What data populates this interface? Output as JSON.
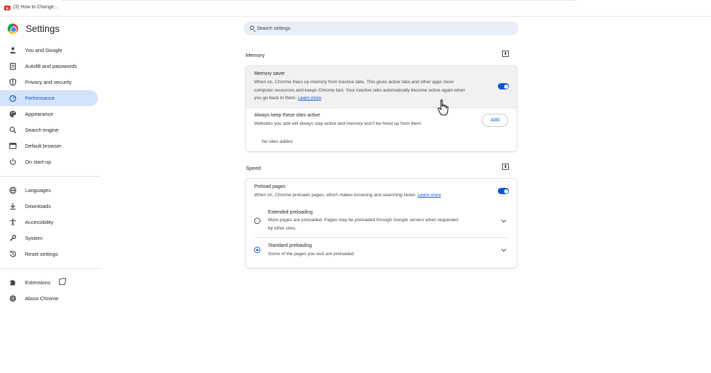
{
  "tab": {
    "title": "(3) How to Change..."
  },
  "header": {
    "title": "Settings"
  },
  "search": {
    "placeholder": "Search settings"
  },
  "sidebar": {
    "items": [
      {
        "label": "You and Google",
        "icon": "person-icon"
      },
      {
        "label": "Autofill and passwords",
        "icon": "clipboard-icon"
      },
      {
        "label": "Privacy and security",
        "icon": "shield-icon"
      },
      {
        "label": "Performance",
        "icon": "speedometer-icon",
        "active": true
      },
      {
        "label": "Appearance",
        "icon": "palette-icon"
      },
      {
        "label": "Search engine",
        "icon": "search-icon"
      },
      {
        "label": "Default browser",
        "icon": "browser-window-icon"
      },
      {
        "label": "On start-up",
        "icon": "power-icon"
      }
    ],
    "items2": [
      {
        "label": "Languages",
        "icon": "globe-icon"
      },
      {
        "label": "Downloads",
        "icon": "download-icon"
      },
      {
        "label": "Accessibility",
        "icon": "accessibility-icon"
      },
      {
        "label": "System",
        "icon": "wrench-icon"
      },
      {
        "label": "Reset settings",
        "icon": "reset-history-icon"
      }
    ],
    "items3": [
      {
        "label": "Extensions",
        "icon": "puzzle-icon"
      },
      {
        "label": "About Chrome",
        "icon": "chrome-icon"
      }
    ]
  },
  "memory": {
    "title": "Memory",
    "saver_title": "Memory saver",
    "saver_desc_1": "When on, Chrome frees up memory from inactive tabs. This gives active tabs and other apps more",
    "saver_desc_2": "computer resources and keeps Chrome fast. Your inactive tabs automatically become active again when",
    "saver_desc_3": "you go back to them.",
    "saver_link": "Learn more",
    "saver_enabled": true,
    "keep_title": "Always keep these sites active",
    "keep_desc": "Websites you add will always stay active and memory won't be freed up from them.",
    "add_label": "Add",
    "empty_label": "No sites added"
  },
  "speed": {
    "title": "Speed",
    "preload_title": "Preload pages",
    "preload_desc": "When on, Chrome preloads pages, which makes browsing and searching faster.",
    "preload_link": "Learn more",
    "preload_enabled": true,
    "extended_title": "Extended preloading",
    "extended_desc_1": "More pages are preloaded. Pages may be preloaded through Google servers when requested",
    "extended_desc_2": "by other sites.",
    "standard_title": "Standard preloading",
    "standard_desc": "Some of the pages you visit are preloaded",
    "selected": "standard"
  },
  "colors": {
    "accent": "#0b57d0",
    "active_bg": "#d3e3fd",
    "search_bg": "#e9eef6"
  }
}
